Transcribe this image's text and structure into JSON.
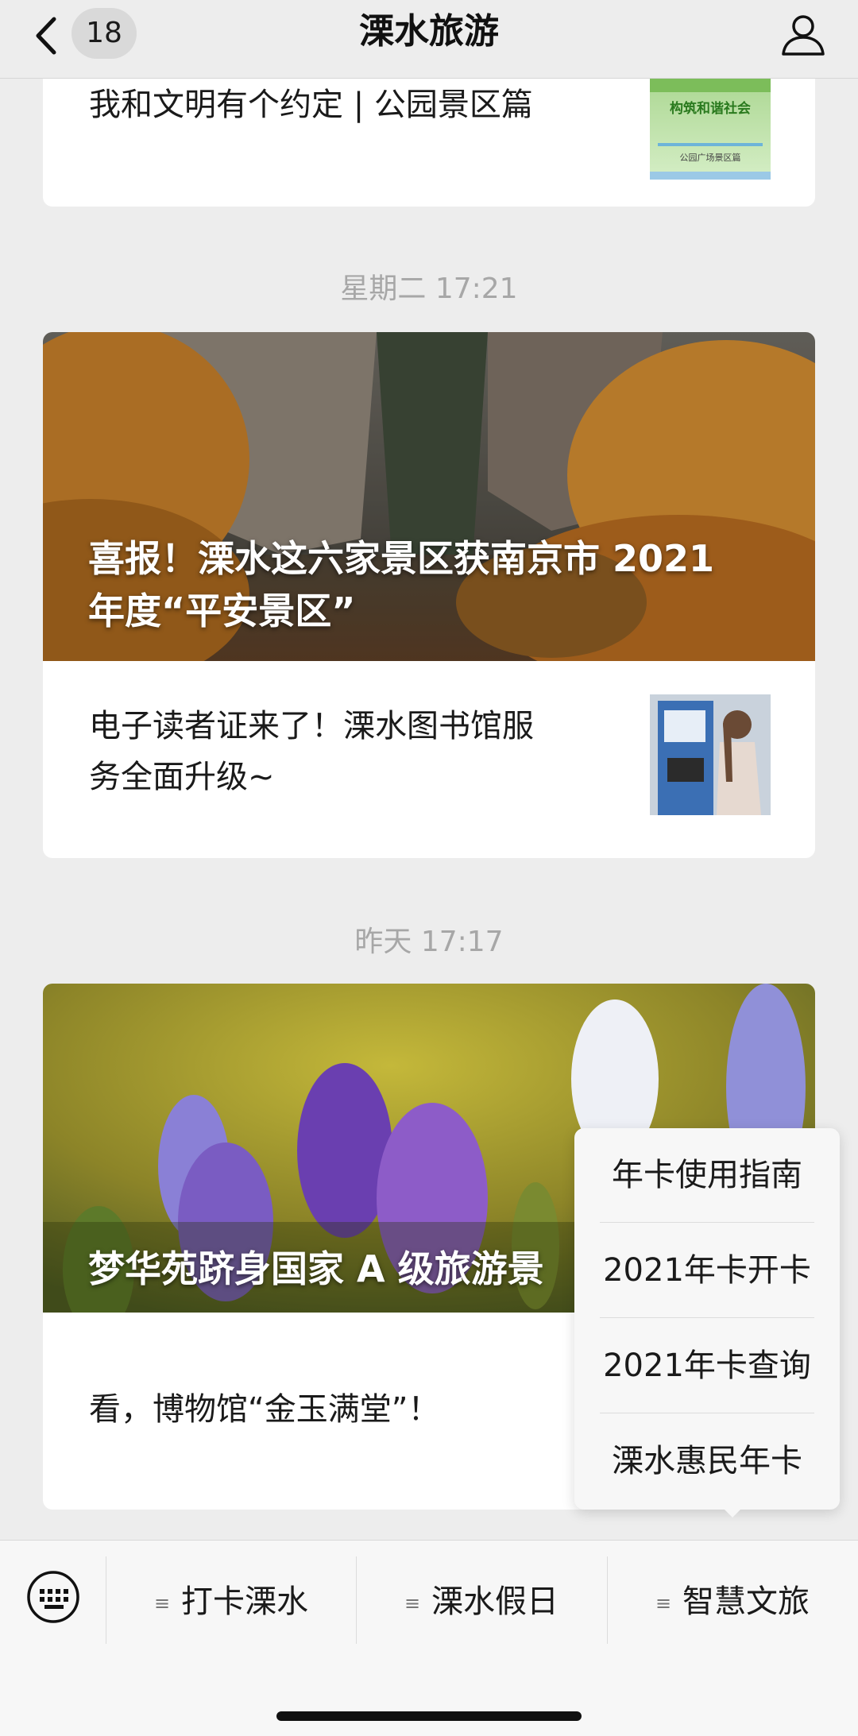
{
  "header": {
    "unread_count": "18",
    "title": "溧水旅游",
    "icons": {
      "back": "chevron-left-icon",
      "profile": "person-icon"
    }
  },
  "messages": {
    "card1": {
      "title": "我和文明有个约定 | 公园景区篇",
      "thumb_text": [
        "构筑和谐社会",
        "公园广场景区篇"
      ]
    },
    "time1": "星期二 17:21",
    "card2": {
      "cover_title": "喜报！溧水这六家景区获南京市 2021 年度“平安景区”",
      "cover_title_line1": "喜报！溧水这六家景区获南京市 2021",
      "cover_title_line2": "年度“平安景区”",
      "sub_title_line1": "电子读者证来了！溧水图书馆服",
      "sub_title_line2": "务全面升级~"
    },
    "time2": "昨天 17:17",
    "card3": {
      "cover_title": "梦华苑跻身国家 A 级旅游景区",
      "cover_title_visible": "梦华苑跻身国家 A 级旅游景",
      "sub_title": "看，博物馆“金玉满堂”！"
    }
  },
  "popup_menu": {
    "items": [
      "年卡使用指南",
      "2021年卡开卡",
      "2021年卡查询",
      "溧水惠民年卡"
    ]
  },
  "bottom_menu": {
    "keyboard_icon": "keyboard-icon",
    "tabs": [
      "打卡溧水",
      "溧水假日",
      "智慧文旅"
    ],
    "menu_glyph": "≡"
  },
  "colors": {
    "background": "#ededed",
    "card": "#ffffff",
    "timestamp": "#a7a7a7"
  }
}
